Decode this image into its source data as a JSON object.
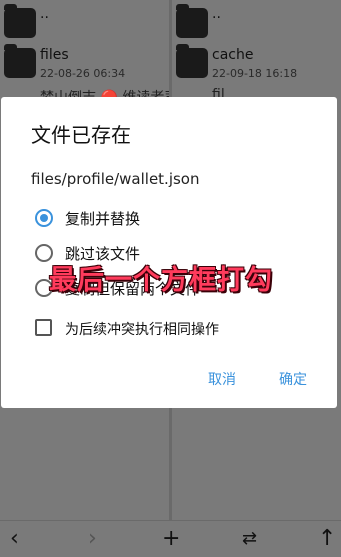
{
  "left_pane": {
    "parent": "..",
    "items": [
      {
        "name": "files",
        "date": "22-08-26 06:34"
      }
    ],
    "partial_text": "梦山倒志 🔴 维读者司"
  },
  "right_pane": {
    "parent": "..",
    "items": [
      {
        "name": "cache",
        "date": "22-09-18 16:18"
      }
    ],
    "partial_text": "fil"
  },
  "dialog": {
    "title": "文件已存在",
    "path": "files/profile/wallet.json",
    "options": [
      {
        "label": "复制并替换",
        "selected": true
      },
      {
        "label": "跳过该文件",
        "selected": false
      },
      {
        "label": "复制但保留两个文件",
        "selected": false
      }
    ],
    "checkbox_label": "为后续冲突执行相同操作",
    "checkbox_checked": false,
    "cancel_label": "取消",
    "confirm_label": "确定"
  },
  "annotation": "最后一个方框打勾",
  "bottom_bar": {
    "icons": [
      "chevron-left-icon",
      "chevron-right-icon",
      "plus-icon",
      "swap-icon",
      "up-arrow-icon"
    ]
  },
  "accent_color": "#3a92dc"
}
